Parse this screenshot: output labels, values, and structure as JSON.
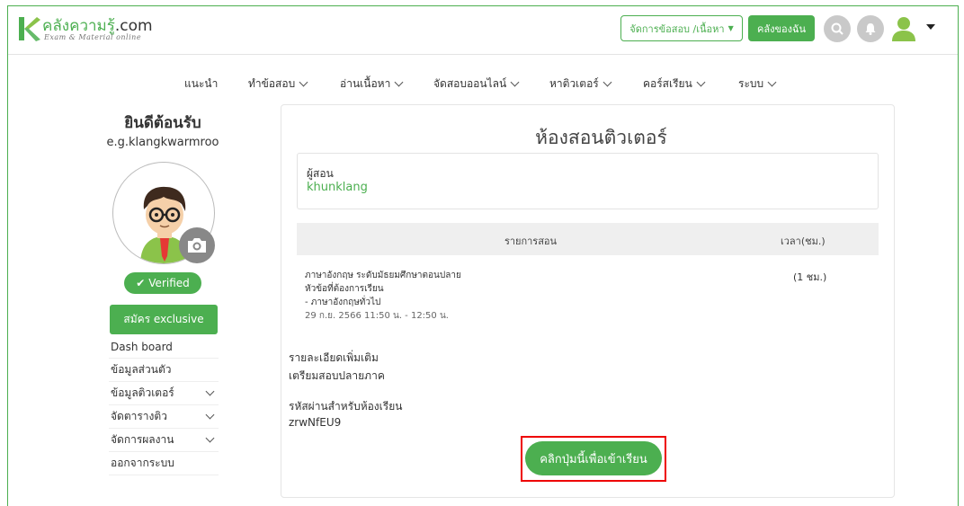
{
  "brand": {
    "name_thai": "คลังความรู้",
    "name_suffix": ".com",
    "tagline": "Exam & Material online",
    "color": "#4caf50"
  },
  "header": {
    "manage_button": "จัดการข้อสอบ /เนื้อหา",
    "library_button": "คลังของฉัน",
    "icons": [
      "search-icon",
      "bell-icon",
      "user-icon",
      "caret-down-icon"
    ]
  },
  "nav": {
    "items": [
      {
        "label": "แนะนำ"
      },
      {
        "label": "ทำข้อสอบ"
      },
      {
        "label": "อ่านเนื้อหา"
      },
      {
        "label": "จัดสอบออนไลน์"
      },
      {
        "label": "หาติวเตอร์"
      },
      {
        "label": "คอร์สเรียน"
      },
      {
        "label": "ระบบ"
      }
    ]
  },
  "sidebar": {
    "welcome": "ยินดีต้อนรับ",
    "email": "e.g.klangkwarmroo",
    "verified": "Verified",
    "exclusive_button": "สมัคร exclusive",
    "menu": [
      {
        "label": "Dash board"
      },
      {
        "label": "ข้อมูลส่วนตัว"
      },
      {
        "label": "ข้อมูลติวเตอร์"
      },
      {
        "label": "จัดตารางติว"
      },
      {
        "label": "จัดการผลงาน"
      },
      {
        "label": "ออกจากระบบ"
      }
    ]
  },
  "main": {
    "title": "ห้องสอนติวเตอร์",
    "teacher_label": "ผู้สอน",
    "teacher_name": "khunklang",
    "table": {
      "col_list": "รายการสอน",
      "col_time": "เวลา(ชม.)",
      "row": {
        "line1": "ภาษาอังกฤษ ระดับมัธยมศึกษาตอนปลาย",
        "line2": "หัวข้อที่ต้องการเรียน",
        "line3": "- ภาษาอังกฤษทั่วไป",
        "line4": "29 ก.ย. 2566 11:50 น. - 12:50 น.",
        "time": "(1 ชม.)"
      }
    },
    "detail_label": "รายละเอียดเพิ่มเติม",
    "detail_value": "เตรียมสอบปลายภาค",
    "passcode_label": "รหัสผ่านสำหรับห้องเรียน",
    "passcode_value": "zrwNfEU9",
    "enter_button": "คลิกปุ่มนี้เพื่อเข้าเรียน"
  }
}
